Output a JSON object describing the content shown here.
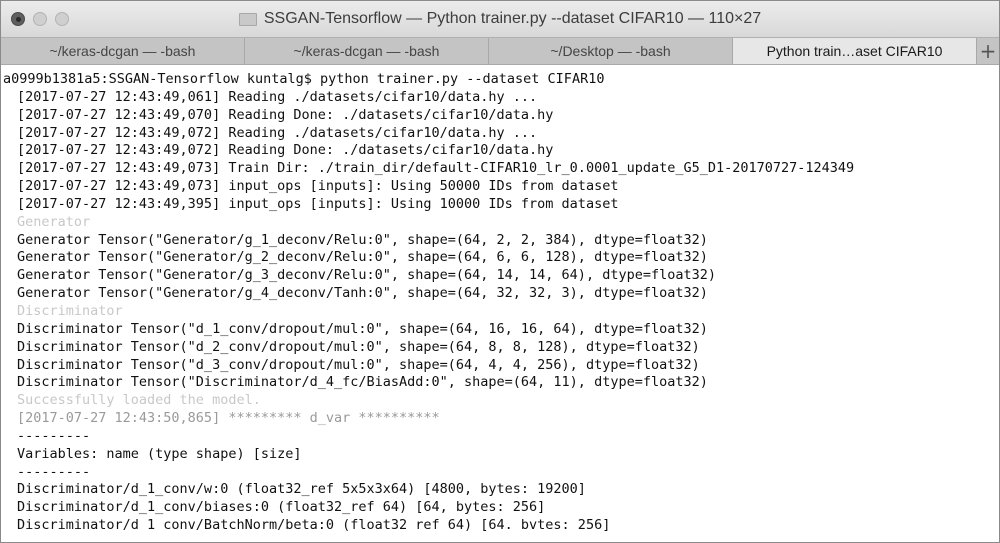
{
  "window": {
    "title": "SSGAN-Tensorflow — Python trainer.py --dataset CIFAR10 — 110×27"
  },
  "tabs": [
    {
      "label": "~/keras-dcgan — -bash",
      "active": false
    },
    {
      "label": "~/keras-dcgan — -bash",
      "active": false
    },
    {
      "label": "~/Desktop — -bash",
      "active": false
    },
    {
      "label": "Python train…aset CIFAR10",
      "active": true
    }
  ],
  "new_tab_label": "+",
  "terminal": {
    "lines": [
      "a0999b1381a5:SSGAN-Tensorflow kuntalg$ python trainer.py --dataset CIFAR10",
      "[2017-07-27 12:43:49,061] Reading ./datasets/cifar10/data.hy ...",
      "[2017-07-27 12:43:49,070] Reading Done: ./datasets/cifar10/data.hy",
      "[2017-07-27 12:43:49,072] Reading ./datasets/cifar10/data.hy ...",
      "[2017-07-27 12:43:49,072] Reading Done: ./datasets/cifar10/data.hy",
      "[2017-07-27 12:43:49,073] Train Dir: ./train_dir/default-CIFAR10_lr_0.0001_update_G5_D1-20170727-124349",
      "[2017-07-27 12:43:49,073] input_ops [inputs]: Using 50000 IDs from dataset",
      "[2017-07-27 12:43:49,395] input_ops [inputs]: Using 10000 IDs from dataset",
      "Generator",
      "Generator Tensor(\"Generator/g_1_deconv/Relu:0\", shape=(64, 2, 2, 384), dtype=float32)",
      "Generator Tensor(\"Generator/g_2_deconv/Relu:0\", shape=(64, 6, 6, 128), dtype=float32)",
      "Generator Tensor(\"Generator/g_3_deconv/Relu:0\", shape=(64, 14, 14, 64), dtype=float32)",
      "Generator Tensor(\"Generator/g_4_deconv/Tanh:0\", shape=(64, 32, 32, 3), dtype=float32)",
      "Discriminator",
      "Discriminator Tensor(\"d_1_conv/dropout/mul:0\", shape=(64, 16, 16, 64), dtype=float32)",
      "Discriminator Tensor(\"d_2_conv/dropout/mul:0\", shape=(64, 8, 8, 128), dtype=float32)",
      "Discriminator Tensor(\"d_3_conv/dropout/mul:0\", shape=(64, 4, 4, 256), dtype=float32)",
      "Discriminator Tensor(\"Discriminator/d_4_fc/BiasAdd:0\", shape=(64, 11), dtype=float32)",
      "Successfully loaded the model.",
      "[2017-07-27 12:43:50,865] ********* d_var **********",
      "---------",
      "Variables: name (type shape) [size]",
      "---------",
      "Discriminator/d_1_conv/w:0 (float32_ref 5x5x3x64) [4800, bytes: 19200]",
      "Discriminator/d_1_conv/biases:0 (float32_ref 64) [64, bytes: 256]",
      "Discriminator/d 1 conv/BatchNorm/beta:0 (float32 ref 64) [64. bvtes: 256]"
    ],
    "line_styles": [
      "prompt",
      "",
      "",
      "",
      "",
      "",
      "",
      "",
      "dim",
      "",
      "",
      "",
      "",
      "dim",
      "",
      "",
      "",
      "",
      "dim",
      "muted",
      "",
      "",
      "",
      "",
      "",
      ""
    ]
  }
}
